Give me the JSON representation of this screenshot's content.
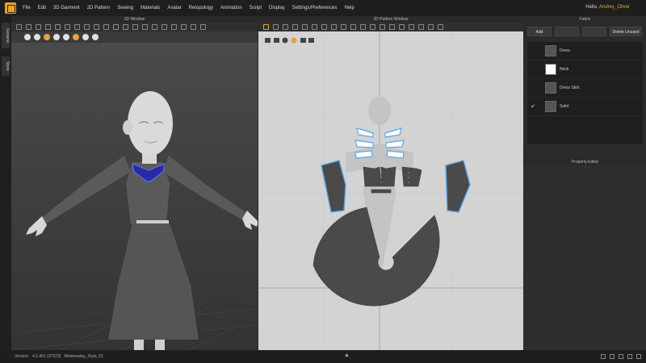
{
  "menu": {
    "items": [
      "File",
      "Edit",
      "3D Garment",
      "2D Pattern",
      "Sewing",
      "Materials",
      "Avatar",
      "Retopology",
      "Animation",
      "Script",
      "Display",
      "Settings/Preferences",
      "Help"
    ],
    "greeting": "Hello,",
    "username": "Andrey_Oliver"
  },
  "sidetabs": {
    "general": "General",
    "store": "Store"
  },
  "window3d": {
    "title": "3D Window"
  },
  "window2d": {
    "title": "2D Pattern Window"
  },
  "fabric": {
    "title": "Fabric",
    "buttons": {
      "add": "Add",
      "copy": "",
      "apply": "",
      "delete_unused": "Delete Unused"
    },
    "items": [
      {
        "name": "Dress",
        "swatch": "#555555",
        "checked": false
      },
      {
        "name": "Neck",
        "swatch": "#ffffff",
        "checked": false
      },
      {
        "name": "Dress Skirt",
        "swatch": "#555555",
        "checked": false
      },
      {
        "name": "Solid",
        "swatch": "#555555",
        "checked": true
      }
    ]
  },
  "property_editor": {
    "title": "Property Editor"
  },
  "status": {
    "version_label": "Version:",
    "version": "4.1.401 (37223)",
    "file": "Wednesday_Style_01"
  },
  "colors": {
    "accent": "#e8a13a",
    "pattern_piece": "#4a4a4a",
    "selection": "#5aa6e8"
  }
}
